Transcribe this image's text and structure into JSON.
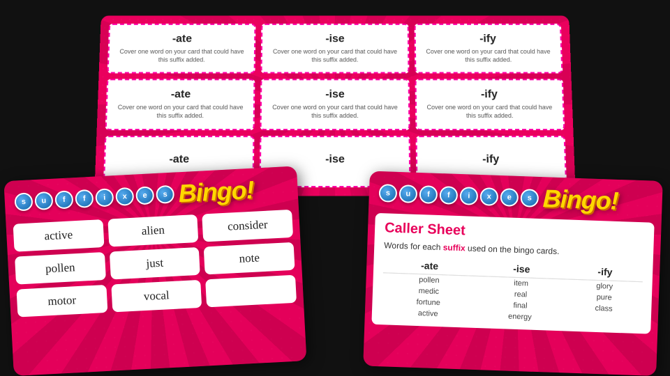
{
  "scene": {
    "background_color": "#111111"
  },
  "top_cards": {
    "cards": [
      {
        "title": "-ate",
        "text": "Cover one word on your card that could have this suffix added."
      },
      {
        "title": "-ise",
        "text": "Cover one word on your card that could have this suffix added."
      },
      {
        "title": "-ify",
        "text": "Cover one word on your card that could have this suffix added."
      },
      {
        "title": "-ate",
        "text": "Cover one word on your card that could have this suffix added."
      },
      {
        "title": "-ise",
        "text": "Cover one word on your card that could have this suffix added."
      },
      {
        "title": "-ify",
        "text": "Cover one word on your card that could have this suffix added."
      },
      {
        "title": "-ate",
        "text": ""
      },
      {
        "title": "-ise",
        "text": ""
      },
      {
        "title": "-ify",
        "text": ""
      }
    ]
  },
  "bingo_card": {
    "letters": [
      "s",
      "u",
      "f",
      "f",
      "i",
      "x",
      "e",
      "s"
    ],
    "title": "Bingo!",
    "cells": [
      "active",
      "alien",
      "consider",
      "pollen",
      "just",
      "note",
      "motor",
      "vocal",
      ""
    ]
  },
  "caller_sheet": {
    "letters": [
      "s",
      "u",
      "f",
      "f",
      "i",
      "x",
      "e",
      "s"
    ],
    "title": "Bingo!",
    "heading": "Caller Sheet",
    "subtitle_start": "Words for each ",
    "subtitle_highlight": "suffix",
    "subtitle_end": " used on the bingo cards.",
    "columns": [
      "-ate",
      "-ise",
      "-ify"
    ],
    "rows": {
      "ate": [
        "pollen",
        "medic",
        "fortune",
        "active"
      ],
      "ise": [
        "item",
        "real",
        "final",
        "energy"
      ],
      "ify": [
        "glory",
        "pure",
        "class"
      ]
    }
  }
}
